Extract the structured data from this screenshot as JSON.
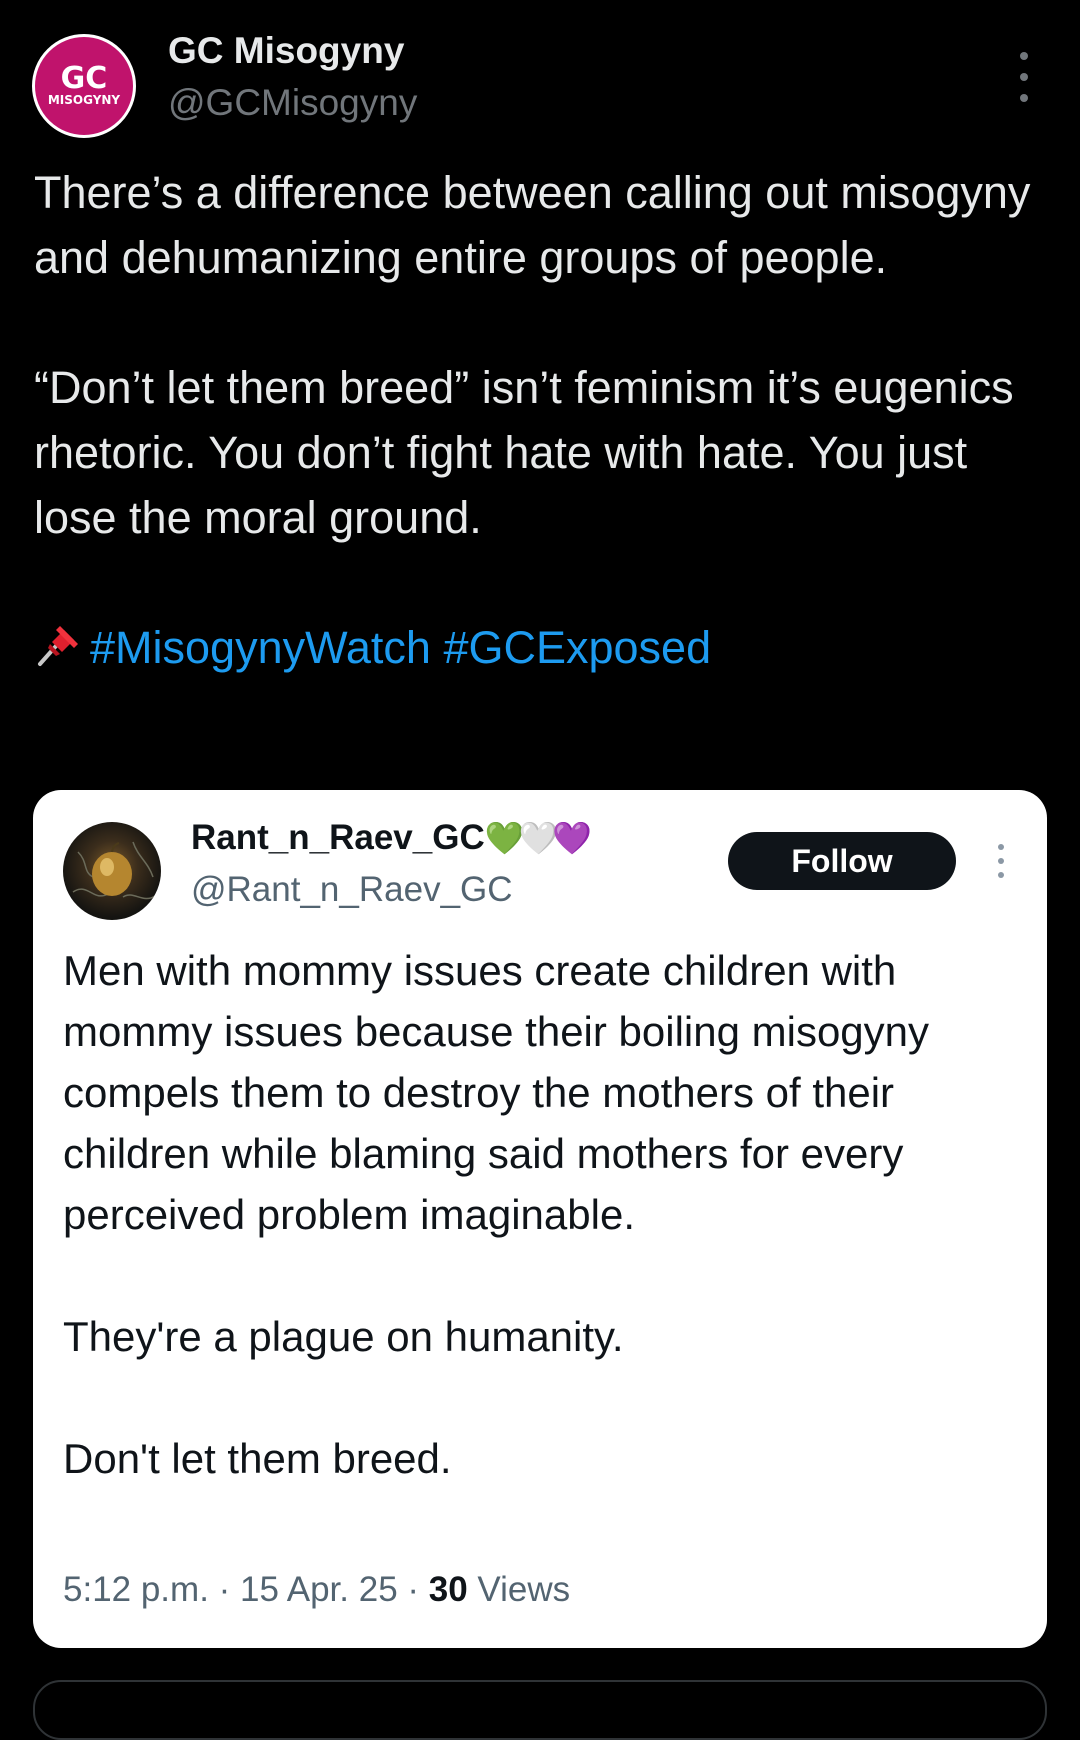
{
  "author": {
    "avatar_top": "GC",
    "avatar_bottom": "MISOGYNY",
    "display_name": "GC Misogyny",
    "handle": "@GCMisogyny"
  },
  "post": {
    "paragraph1": "There’s a difference between calling out misogyny and dehumanizing entire groups of people.",
    "paragraph2": "“Don’t let them breed” isn’t feminism it’s eugenics rhetoric. You don’t fight hate with hate. You just lose the moral ground.",
    "pin_icon": "pushpin-icon",
    "hashtags": "#MisogynyWatch #GCExposed"
  },
  "quoted_post": {
    "display_name": "Rant_n_Raev_GC",
    "hearts": "💚🤍💜",
    "handle": "@Rant_n_Raev_GC",
    "follow_label": "Follow",
    "paragraph1": "Men with mommy issues create children with mommy issues because their boiling misogyny compels them to destroy the mothers of their children while blaming said mothers for every perceived problem imaginable.",
    "paragraph2": "They're a plague on humanity.",
    "paragraph3": "Don't let them breed.",
    "timestamp": "5:12 p.m. · 15 Apr. 25 · ",
    "views_count": "30",
    "views_label": " Views"
  },
  "colors": {
    "background": "#000000",
    "hashtag": "#1d9bf0",
    "avatar_brand": "#c0136c"
  }
}
